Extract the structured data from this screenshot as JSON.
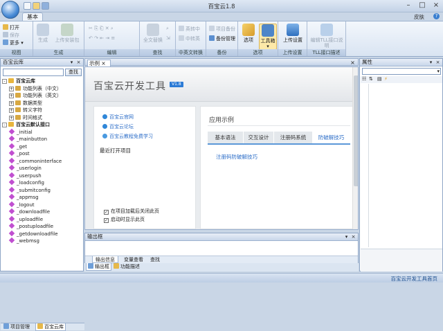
{
  "window": {
    "title": "百宝云1.8"
  },
  "ribbon": {
    "tab": "基本",
    "skin": "皮肤",
    "groups": {
      "view": {
        "title": "视图",
        "open": "打开",
        "save": "保存",
        "more": "更多"
      },
      "generate": {
        "title": "生成",
        "build": "生成",
        "upload_pkg": "上传安装包"
      },
      "edit": {
        "title": "编辑"
      },
      "replace": {
        "title": "查找",
        "full_replace": "全文替换"
      },
      "cn": {
        "title": "中英文转换",
        "to_en": "英转中",
        "to_cn": "中转英"
      },
      "backup": {
        "title": "备份",
        "project_backup": "项目备份",
        "backup_mgmt": "备份管理"
      },
      "options": {
        "title": "选项",
        "options_btn": "选项",
        "toolbox": "工具箱"
      },
      "upload": {
        "title": "上传设置",
        "upload_settings": "上传设置"
      },
      "tll": {
        "title": "TLL接口描述",
        "edit_tll": "编辑TLL接口说明"
      }
    }
  },
  "left_panel": {
    "title": "百宝云库",
    "search_btn": "查找",
    "tree": [
      {
        "label": "百宝云库",
        "level": 0,
        "kind": "folder",
        "bold": true,
        "box": "-"
      },
      {
        "label": "功能列表（中文）",
        "level": 1,
        "kind": "folder",
        "box": "+"
      },
      {
        "label": "功能列表（英文）",
        "level": 1,
        "kind": "folder",
        "box": "+"
      },
      {
        "label": "数据类型",
        "level": 1,
        "kind": "folder",
        "box": "+"
      },
      {
        "label": "转义字符",
        "level": 1,
        "kind": "folder",
        "box": "+"
      },
      {
        "label": "时间格式",
        "level": 1,
        "kind": "folder",
        "box": "+"
      },
      {
        "label": "百宝云默认接口",
        "level": 0,
        "kind": "folder",
        "bold": true,
        "box": "-"
      },
      {
        "label": "_initial",
        "level": 1,
        "kind": "gem"
      },
      {
        "label": "_mainbutton",
        "level": 1,
        "kind": "gem"
      },
      {
        "label": "_get",
        "level": 1,
        "kind": "gem"
      },
      {
        "label": "_post",
        "level": 1,
        "kind": "gem"
      },
      {
        "label": "_commoninterface",
        "level": 1,
        "kind": "gem"
      },
      {
        "label": "_userlogin",
        "level": 1,
        "kind": "gem"
      },
      {
        "label": "_userpush",
        "level": 1,
        "kind": "gem"
      },
      {
        "label": "_loadconfig",
        "level": 1,
        "kind": "gem"
      },
      {
        "label": "_submitconfig",
        "level": 1,
        "kind": "gem"
      },
      {
        "label": "_appmsg",
        "level": 1,
        "kind": "gem"
      },
      {
        "label": "_logout",
        "level": 1,
        "kind": "gem"
      },
      {
        "label": "_downloadfile",
        "level": 1,
        "kind": "gem"
      },
      {
        "label": "_uploadfile",
        "level": 1,
        "kind": "gem"
      },
      {
        "label": "_postuploadfile",
        "level": 1,
        "kind": "gem"
      },
      {
        "label": "_getdownloadfile",
        "level": 1,
        "kind": "gem"
      },
      {
        "label": "_webmsg",
        "level": 1,
        "kind": "gem"
      }
    ],
    "tabs": [
      "项目管理",
      "百宝云库"
    ]
  },
  "document": {
    "tab": "示例",
    "header_title": "百宝云开发工具",
    "version": "V1.8",
    "links": [
      "百宝云官网",
      "百宝云论坛",
      "百宝云教程免费学习"
    ],
    "recent_label": "最近打开项目",
    "checks": [
      {
        "label": "在项目加载后关闭此页",
        "checked": true
      },
      {
        "label": "启动时显示此页",
        "checked": true
      }
    ],
    "sample": {
      "title": "应用示例",
      "tabs": [
        "基本语法",
        "交互设计",
        "注册码系统",
        "防破解技巧"
      ],
      "active_tab": 3,
      "link": "注册码防破解技巧"
    }
  },
  "props_panel": {
    "title": "属性"
  },
  "output": {
    "title": "输出框",
    "tabs": [
      "输出信息",
      "变量查看",
      "查找"
    ],
    "bottom_tabs": [
      "输出框",
      "功能描述"
    ]
  },
  "status": {
    "text": "百宝云开发工具首页"
  },
  "colors": {
    "accent": "#2d6ec8",
    "version_badge": "#2c7bd6",
    "gem": "#c04fd0",
    "ribbon_title": "#b7c9e2"
  }
}
